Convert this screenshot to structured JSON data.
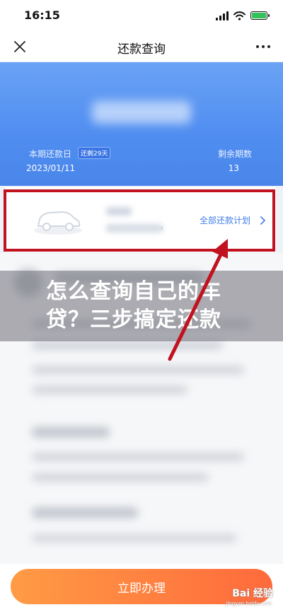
{
  "status_bar": {
    "time": "16:15"
  },
  "nav": {
    "title": "还款查询"
  },
  "summary": {
    "due_label": "本期还款日",
    "due_badge": "还剩29天",
    "due_date": "2023/01/11",
    "remaining_label": "剩余期数",
    "remaining_value": "13"
  },
  "plan_card": {
    "link_label": "全部还款计划"
  },
  "overlay": {
    "headline": "怎么查询自己的车贷？三步搞定还款"
  },
  "footer": {
    "cta_label": "立即办理"
  },
  "watermark": {
    "brand": "Bai 经验",
    "url": "jingyan.baidu.com"
  },
  "colors": {
    "hero_blue": "#4f8df0",
    "link_blue": "#3f7ee8",
    "highlight_red": "#c0121f",
    "cta_orange": "#ff7a3f"
  },
  "icons": [
    "close-icon",
    "more-icon",
    "car-icon",
    "chevron-right-icon",
    "signal-icon",
    "wifi-icon",
    "battery-icon"
  ]
}
